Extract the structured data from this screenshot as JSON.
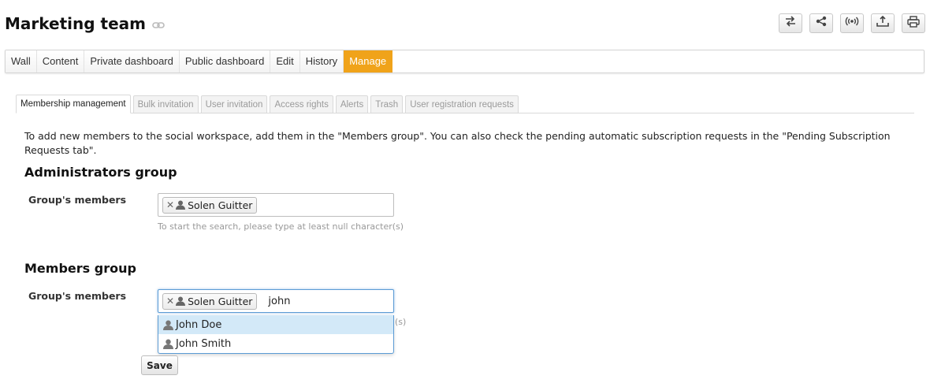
{
  "header": {
    "title": "Marketing team",
    "toolbar_icons": [
      "switch-icon",
      "share-icon",
      "broadcast-icon",
      "export-icon",
      "print-icon"
    ]
  },
  "main_tabs": [
    {
      "label": "Wall"
    },
    {
      "label": "Content"
    },
    {
      "label": "Private dashboard"
    },
    {
      "label": "Public dashboard"
    },
    {
      "label": "Edit"
    },
    {
      "label": "History"
    },
    {
      "label": "Manage",
      "active": true
    }
  ],
  "sub_tabs": [
    {
      "label": "Membership management",
      "active": true
    },
    {
      "label": "Bulk invitation"
    },
    {
      "label": "User invitation"
    },
    {
      "label": "Access rights"
    },
    {
      "label": "Alerts"
    },
    {
      "label": "Trash"
    },
    {
      "label": "User registration requests"
    }
  ],
  "intro_text": "To add new members to the social workspace, add them in the \"Members group\". You can also check the pending automatic subscription requests in the \"Pending Subscription Requests tab\".",
  "admins": {
    "heading": "Administrators group",
    "label": "Group's members",
    "members": [
      "Solen Guitter"
    ],
    "hint": "To start the search, please type at least null character(s)"
  },
  "members_group": {
    "heading": "Members group",
    "label": "Group's members",
    "members": [
      "Solen Guitter"
    ],
    "search_value": "john",
    "hint_visible_fragment": "(s)",
    "suggestions": [
      "John Doe",
      "John Smith"
    ]
  },
  "save_label": "Save",
  "colors": {
    "accent": "#f0a31a",
    "highlight": "#d3e9f8",
    "focus": "#5b9bd5"
  }
}
